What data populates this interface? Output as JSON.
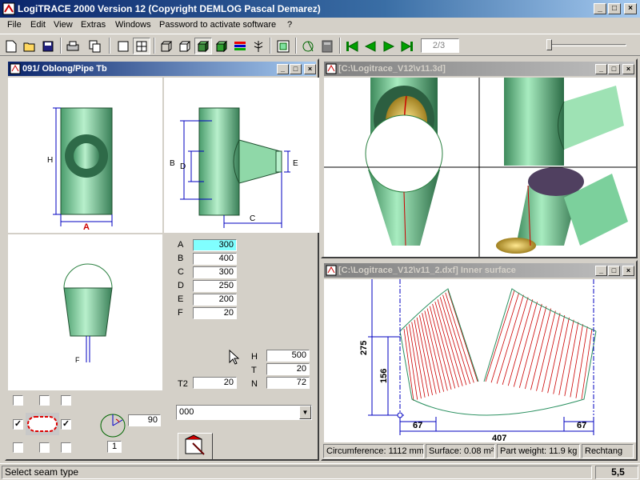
{
  "app": {
    "title": "LogiTRACE 2000  Version 12  (Copyright DEMLOG Pascal Demarez)",
    "min": "_",
    "max": "□",
    "close": "×"
  },
  "menu": [
    "File",
    "Edit",
    "View",
    "Extras",
    "Windows",
    "Password to activate software",
    "?"
  ],
  "toolbar": {
    "page_indicator": "2/3",
    "slider_value": 0
  },
  "win_params": {
    "title": "091/ Oblong/Pipe Tb",
    "dims": [
      {
        "label": "A",
        "value": "300"
      },
      {
        "label": "B",
        "value": "400"
      },
      {
        "label": "C",
        "value": "300"
      },
      {
        "label": "D",
        "value": "250"
      },
      {
        "label": "E",
        "value": "200"
      },
      {
        "label": "F",
        "value": "20"
      }
    ],
    "right_dims": [
      {
        "label": "H",
        "value": "500"
      },
      {
        "label": "T",
        "value": "20"
      },
      {
        "label": "N",
        "value": "72"
      }
    ],
    "t2": {
      "label": "T2",
      "value": "20"
    },
    "angle_value": "90",
    "small_value": "1",
    "dropdown_value": "000",
    "drawing_labels": {
      "H": "H",
      "A": "A",
      "B": "B",
      "D": "D",
      "C": "C",
      "E": "E",
      "F": "F"
    },
    "checks": [
      "",
      "",
      "",
      "✓",
      "✓",
      "",
      "",
      ""
    ]
  },
  "win_3d": {
    "title": "[C:\\Logitrace_V12\\v11.3d]"
  },
  "win_dxf": {
    "title": "[C:\\Logitrace_V12\\v11_2.dxf]  Inner surface",
    "dims": {
      "height_total": "275",
      "height_inner": "156",
      "left_gap": "67",
      "right_gap": "67",
      "width": "407"
    },
    "info": [
      "Circumference: 1112 mm",
      "Surface: 0.08 m²",
      "Part weight: 11.9 kg",
      "Rechtang"
    ]
  },
  "status": {
    "message": "Select seam type",
    "value": "5,5"
  },
  "colors": {
    "pipe": "#8fe0b0",
    "dim": "#0000c0",
    "seam": "#cc0000",
    "title_active": "#0a246a"
  }
}
